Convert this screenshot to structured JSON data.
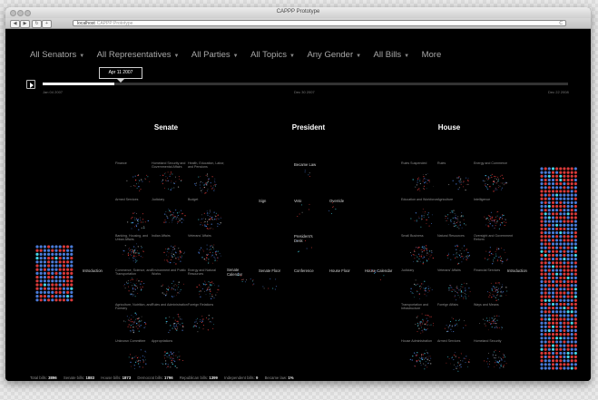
{
  "window": {
    "title": "CAPPP Prototype"
  },
  "browser": {
    "url": "localhost",
    "url_page_title": "CAPPP Prototype",
    "nav_back": "◀",
    "nav_forward": "▶",
    "nav_reload_btn": "↻",
    "nav_add": "+",
    "reload": "C"
  },
  "filters": [
    {
      "label": "All Senators"
    },
    {
      "label": "All Representatives"
    },
    {
      "label": "All Parties"
    },
    {
      "label": "All Topics"
    },
    {
      "label": "Any Gender"
    },
    {
      "label": "All Bills"
    },
    {
      "label": "More"
    }
  ],
  "timeline": {
    "tooltip": "Apr 11 2007",
    "progress": 0.137,
    "dates": [
      "Jan 04 2007",
      "Dec 30 2007",
      "Dec 22 2008"
    ]
  },
  "columns": {
    "senate": "Senate",
    "president": "President",
    "house": "House"
  },
  "senate_committees": [
    "Finance",
    "Homeland Security and Governmental Affairs",
    "Health, Education, Labor, and Pensions",
    "Armed Services",
    "Judiciary",
    "Budget",
    "Banking, Housing, and Urban Affairs",
    "Indian Affairs",
    "Veterans' Affairs",
    "Commerce, Science, and Transportation",
    "Environment and Public Works",
    "Energy and Natural Resources",
    "Agriculture, Nutrition, and Forestry",
    "Rules and Administration",
    "Foreign Relations",
    "Unknown Committee",
    "Appropriations"
  ],
  "house_committees": [
    "Rules Suspended",
    "Rules",
    "Energy and Commerce",
    "Education and Workforce",
    "Agriculture",
    "Intelligence",
    "Small Business",
    "Natural Resources",
    "Oversight and Government Reform",
    "Judiciary",
    "Veterans' Affairs",
    "Financial Services",
    "Transportation and Infrastructure",
    "Foreign Affairs",
    "Ways and Means",
    "House Administration",
    "Armed Services",
    "Homeland Security"
  ],
  "stages": {
    "senate_intro": "Introduction",
    "senate_calendar": "Senate Calendar",
    "senate_floor": "Senate Floor",
    "conference": "Conference",
    "house_floor": "House Floor",
    "house_calendar": "House Calendar",
    "house_intro": "Introduction",
    "sign": "Sign",
    "veto": "Veto",
    "override": "Override",
    "became_law": "Became Law",
    "presidents_desk": "President's Desk"
  },
  "footer": {
    "total_label": "Total bills:",
    "total_value": "3896",
    "senate_label": "Senate bills:",
    "senate_value": "1883",
    "house_label": "House bills:",
    "house_value": "1873",
    "dem_label": "Democrat bills:",
    "dem_value": "1796",
    "rep_label": "Republican bills:",
    "rep_value": "1399",
    "ind_label": "Independent bills:",
    "ind_value": "9",
    "law_label": "Became law:",
    "law_value": "1%"
  },
  "colors": {
    "democrat": "#4a7bd8",
    "republican": "#d93a3a",
    "highlight": "#46d4e6",
    "neutral": "#9a9a9a"
  }
}
